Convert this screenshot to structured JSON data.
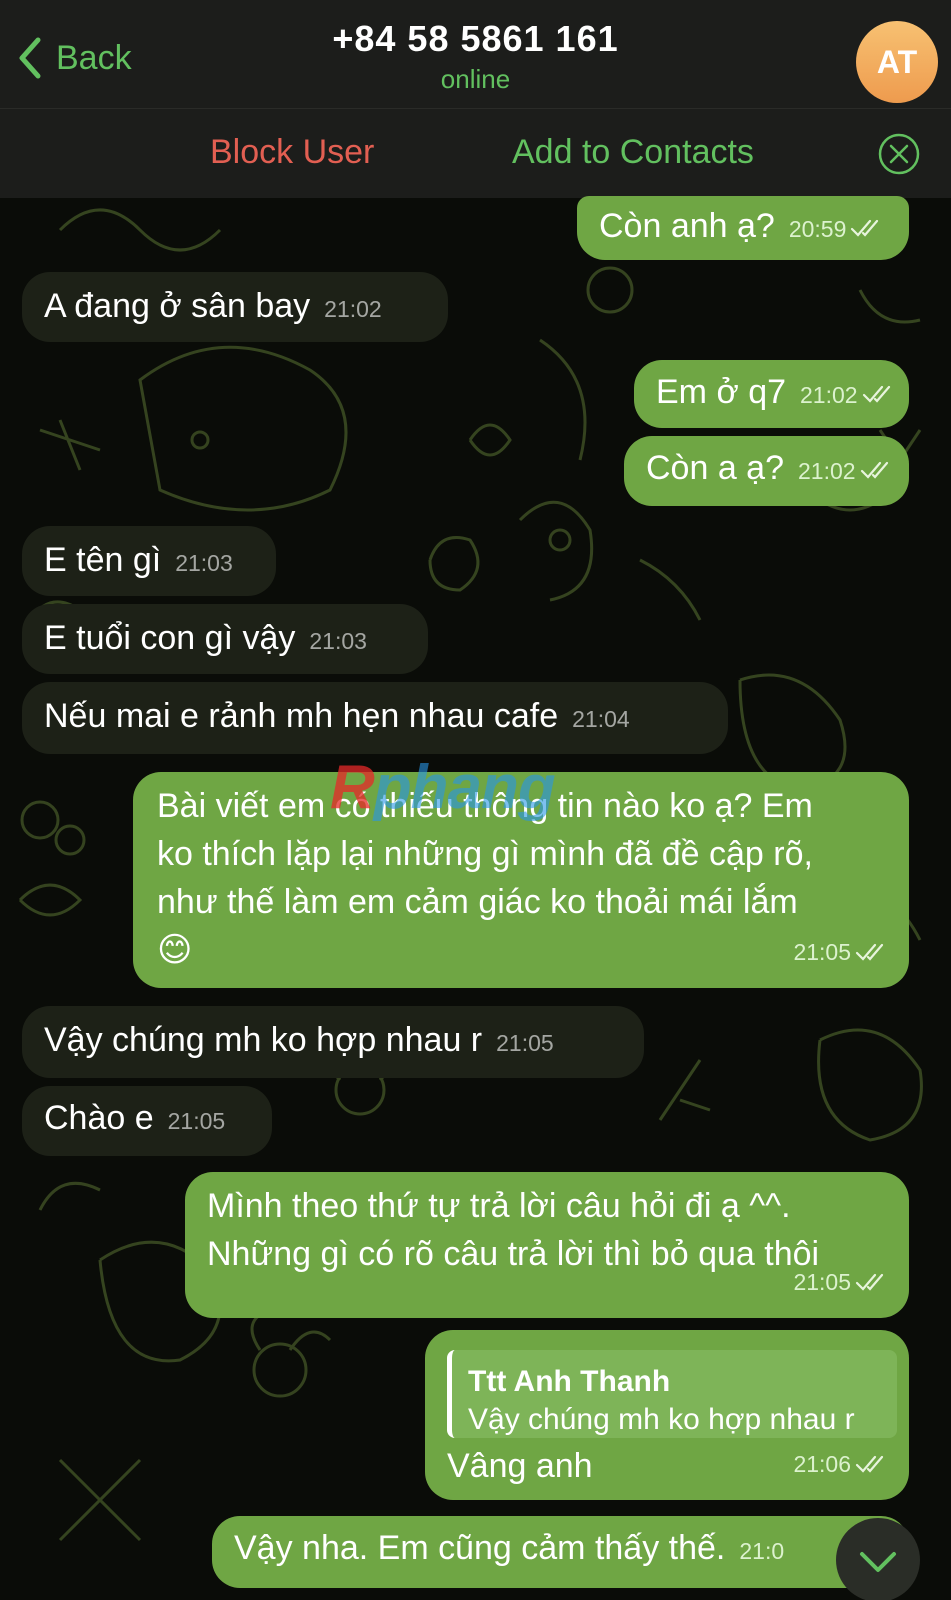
{
  "header": {
    "back_label": "Back",
    "contact_name": "+84 58 5861 161",
    "status": "online",
    "avatar_initials": "AT"
  },
  "action_bar": {
    "block_label": "Block User",
    "add_label": "Add to Contacts"
  },
  "messages": [
    {
      "dir": "out",
      "text": "Còn anh ạ?",
      "time": "20:59"
    },
    {
      "dir": "in",
      "text": "A đang ở sân bay",
      "time": "21:02"
    },
    {
      "dir": "out",
      "text": "Em ở q7",
      "time": "21:02"
    },
    {
      "dir": "out",
      "text": "Còn a ạ?",
      "time": "21:02"
    },
    {
      "dir": "in",
      "text": "E tên gì",
      "time": "21:03"
    },
    {
      "dir": "in",
      "text": "E tuổi con gì vậy",
      "time": "21:03"
    },
    {
      "dir": "in",
      "text": "Nếu mai e rảnh mh hẹn nhau cafe",
      "time": "21:04"
    },
    {
      "dir": "out",
      "lines": [
        "Bài viết em có thiếu thông tin nào ko ạ? Em",
        "ko thích lặp lại những gì mình đã đề cập rõ,",
        "như thế làm em cảm giác ko thoải mái lắm"
      ],
      "emoji": "😊",
      "time": "21:05"
    },
    {
      "dir": "in",
      "text": "Vậy chúng mh ko hợp nhau r",
      "time": "21:05"
    },
    {
      "dir": "in",
      "text": "Chào e",
      "time": "21:05"
    },
    {
      "dir": "out",
      "lines": [
        "Mình theo thứ tự trả lời câu hỏi đi ạ ^^.",
        "Những gì có rõ câu trả lời thì bỏ qua thôi"
      ],
      "time": "21:05"
    },
    {
      "dir": "out",
      "reply_name": "Ttt Anh Thanh",
      "reply_text": "Vậy chúng mh ko hợp nhau r",
      "text": "Vâng anh",
      "time": "21:06"
    },
    {
      "dir": "out",
      "text": "Vậy nha. Em cũng cảm thấy thế.",
      "time": "21:0"
    }
  ],
  "watermark": {
    "first": "R",
    "rest": "phang"
  },
  "colors": {
    "accent_green": "#62c05f",
    "outgoing_bubble": "#6fa644",
    "incoming_bubble": "#1d2117",
    "block_red": "#e25f52",
    "avatar_orange": "#f0a152"
  },
  "icons": {
    "back": "chevron-left-icon",
    "close": "circle-x-icon",
    "read": "double-check-icon",
    "scroll": "chevron-down-icon"
  }
}
